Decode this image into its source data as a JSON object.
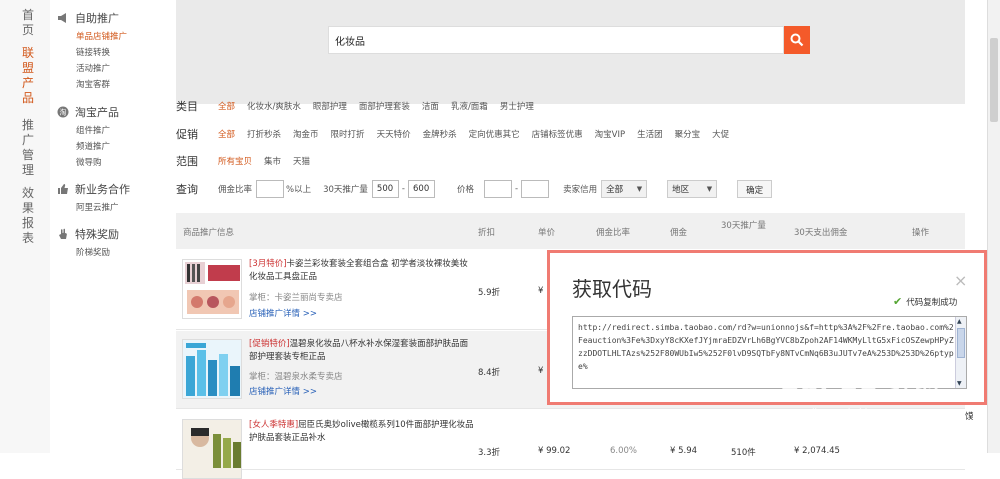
{
  "nav": {
    "groups": [
      {
        "label": "首页",
        "active": false
      },
      {
        "label": "联盟产品",
        "active": true
      },
      {
        "label": "推广管理",
        "active": false
      },
      {
        "label": "效果报表",
        "active": false
      }
    ]
  },
  "subnav": {
    "sections": [
      {
        "title": "自助推广",
        "icon": "megaphone-icon",
        "items": [
          {
            "label": "单品店铺推广",
            "active": true
          },
          {
            "label": "链接转换",
            "active": false
          },
          {
            "label": "活动推广",
            "active": false
          },
          {
            "label": "淘宝客群",
            "active": false
          }
        ]
      },
      {
        "title": "淘宝产品",
        "icon": "taobao-icon",
        "items": [
          {
            "label": "组件推广",
            "active": false
          },
          {
            "label": "频道推广",
            "active": false
          },
          {
            "label": "微导购",
            "active": false
          }
        ]
      },
      {
        "title": "新业务合作",
        "icon": "thumbs-up-icon",
        "items": [
          {
            "label": "阿里云推广",
            "active": false
          }
        ]
      },
      {
        "title": "特殊奖励",
        "icon": "hand-icon",
        "items": [
          {
            "label": "阶梯奖励",
            "active": false
          }
        ]
      }
    ]
  },
  "search": {
    "value": "化妆品"
  },
  "filters": {
    "category": {
      "label": "类目",
      "options": [
        "全部",
        "化妆水/爽肤水",
        "眼部护理",
        "面部护理套装",
        "洁面",
        "乳液/面霜",
        "男士护理"
      ],
      "selected": 0
    },
    "promo": {
      "label": "促销",
      "options": [
        "全部",
        "打折秒杀",
        "淘金币",
        "限时打折",
        "天天特价",
        "金牌秒杀",
        "定向优惠其它",
        "店铺标签优惠",
        "淘宝VIP",
        "生活团",
        "聚分宝",
        "大促"
      ],
      "selected": 0
    },
    "scope": {
      "label": "范围",
      "options": [
        "所有宝贝",
        "集市",
        "天猫"
      ],
      "selected": 0
    },
    "query": {
      "label": "查询",
      "commission_label": "佣金比率",
      "commission_value": "",
      "commission_suffix": "%以上",
      "volume_label": "30天推广量",
      "volume_min": "500",
      "volume_max": "600",
      "price_label": "价格",
      "price_min": "",
      "price_max": "",
      "dash": "-",
      "credit_label": "卖家信用",
      "credit_value": "全部",
      "region_value": "地区",
      "confirm": "确定"
    }
  },
  "table": {
    "headers": [
      "商品推广信息",
      "折扣",
      "单价",
      "佣金比率",
      "佣金",
      "30天推广量",
      "30天支出佣金",
      "操作"
    ],
    "rows": [
      {
        "tag": "[3月特价]",
        "title": "卡姿兰彩妆套装全套组合盒 初学者淡妆裸妆美妆化妆品工具盘正品",
        "shop": "掌柜：卡姿兰丽尚专卖店",
        "detail": "店铺推广详情 >>",
        "discount": "5.9折",
        "price": "¥"
      },
      {
        "tag": "[促销特价]",
        "title": "温碧泉化妆品八杯水补水保湿套装面部护肤品面部护理套装专柜正品",
        "shop": "掌柜：温碧泉水柔专卖店",
        "detail": "店铺推广详情 >>",
        "discount": "8.4折",
        "price": "¥"
      },
      {
        "tag": "[女人季特惠]",
        "title": "屈臣氏奥妙olive橄榄系列10件面部护理化妆品护肤品套装正品补水",
        "shop": "",
        "detail": "",
        "discount": "3.3折",
        "price": "¥ 99.02",
        "rate": "6.00%",
        "commission": "¥ 5.94",
        "volume": "510件",
        "spend": "¥ 2,074.45"
      }
    ]
  },
  "popup": {
    "title": "获取代码",
    "close": "×",
    "copy_status": "代码复制成功",
    "code": "http://redirect.simba.taobao.com/rd?w=unionnojs&f=http%3A%2F%2Fre.taobao.com%2Feauction%3Fe%3DxyY8cKXefJYjmraEDZVrLh6BgYVC8bZpoh2AF14WKMyLltG5xFicOSZewpHPyZzzDDOTLHLTAzs%252F80WUbIw5%252F0lvD9SQTbFy8NTvCmNq6B3uJUTv7eA%253D%253D%26ptype%"
  },
  "side": {
    "text": "馍"
  },
  "watermark": {
    "text": "Bai du 经验",
    "sub": "jingyan.baidu.com"
  }
}
